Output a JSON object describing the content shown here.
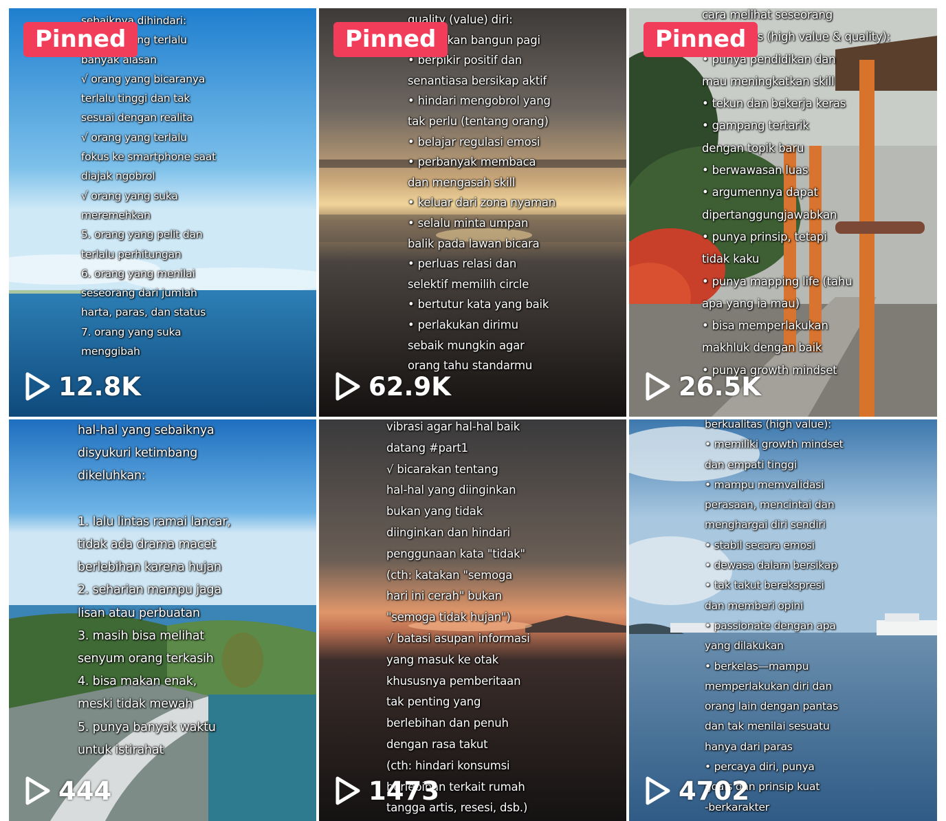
{
  "colors": {
    "pinned_badge": "#f23d5a",
    "text": "#ffffff"
  },
  "icons": {
    "play": "play-outline-icon"
  },
  "videos": [
    {
      "pinned_label": "Pinned",
      "views": "12.8K",
      "caption_lines": [
        "sebaiknya dihindari:",
        "√ orang yang terlalu",
        "banyak alasan",
        "√ orang yang bicaranya",
        "terlalu tinggi dan tak",
        "sesuai dengan realita",
        "√ orang yang terlalu",
        "fokus ke smartphone saat",
        "diajak ngobrol",
        "√ orang yang suka",
        "meremehkan",
        "5. orang yang pelit dan",
        "terlalu perhitungan",
        "6. orang yang menilai",
        "seseorang dari jumlah",
        "harta, paras, dan status",
        "7. orang yang suka",
        "menggibah"
      ]
    },
    {
      "pinned_label": "Pinned",
      "views": "62.9K",
      "caption_lines": [
        "quality (value) diri:",
        "• biasakan bangun pagi",
        "• berpikir positif dan",
        "senantiasa bersikap aktif",
        "• hindari mengobrol yang",
        "tak perlu (tentang orang)",
        "• belajar regulasi emosi",
        "• perbanyak membaca",
        "dan mengasah skill",
        "• keluar dari zona nyaman",
        "• selalu minta umpan",
        "balik pada lawan bicara",
        "• perluas relasi dan",
        "selektif memilih circle",
        "• bertutur kata yang baik",
        "• perlakukan dirimu",
        "sebaik mungkin agar",
        "orang tahu standarmu"
      ]
    },
    {
      "pinned_label": "Pinned",
      "views": "26.5K",
      "caption_lines": [
        "cara melihat seseorang",
        "berkualitas (high value & quality):",
        "• punya pendidikan dan",
        "mau meningkatkan skill",
        "• tekun dan bekerja keras",
        "• gampang tertarik",
        "dengan topik baru",
        "• berwawasan luas",
        "• argumennya dapat",
        "dipertanggungjawabkan",
        "• punya prinsip, tetapi",
        "tidak kaku",
        "• punya mapping life (tahu",
        "apa yang ia mau)",
        "• bisa memperlakukan",
        "makhluk dengan baik",
        "• punya growth mindset"
      ]
    },
    {
      "pinned_label": "",
      "views": "444",
      "caption_lines": [
        "hal-hal yang sebaiknya",
        "disyukuri ketimbang",
        "dikeluhkan:",
        "",
        "1. lalu lintas ramai lancar,",
        "tidak ada drama macet",
        "berlebihan karena hujan",
        "2. seharian mampu jaga",
        "lisan atau perbuatan",
        "3. masih bisa melihat",
        "senyum orang terkasih",
        "4. bisa makan enak,",
        "meski tidak mewah",
        "5. punya banyak waktu",
        "untuk istirahat"
      ]
    },
    {
      "pinned_label": "",
      "views": "1473",
      "caption_lines": [
        "vibrasi agar hal-hal baik",
        "datang #part1",
        "√ bicarakan tentang",
        "hal-hal yang diinginkan",
        "bukan yang tidak",
        "diinginkan dan hindari",
        "penggunaan kata \"tidak\"",
        "(cth: katakan \"semoga",
        "hari ini cerah\" bukan",
        "\"semoga tidak hujan\")",
        "√ batasi asupan informasi",
        "yang masuk ke otak",
        "khususnya pemberitaan",
        "tak penting yang",
        "berlebihan dan penuh",
        "dengan rasa takut",
        "(cth: hindari konsumsi",
        "berlebihan terkait rumah",
        "tangga artis, resesi, dsb.)"
      ]
    },
    {
      "pinned_label": "",
      "views": "4702",
      "caption_lines": [
        "berkualitas (high value):",
        "• memiliki growth mindset",
        "dan empati tinggi",
        "• mampu memvalidasi",
        "perasaan, mencintai dan",
        "menghargai diri sendiri",
        "• stabil secara emosi",
        "• dewasa dalam bersikap",
        "• tak takut berekspresi",
        "dan memberi opini",
        "• passionate dengan apa",
        "yang dilakukan",
        "• berkelas—mampu",
        "memperlakukan diri dan",
        "orang lain dengan pantas",
        "dan tak menilai sesuatu",
        "hanya dari paras",
        "• percaya diri, punya",
        "goals dan prinsip kuat",
        "-berkarakter"
      ]
    }
  ]
}
